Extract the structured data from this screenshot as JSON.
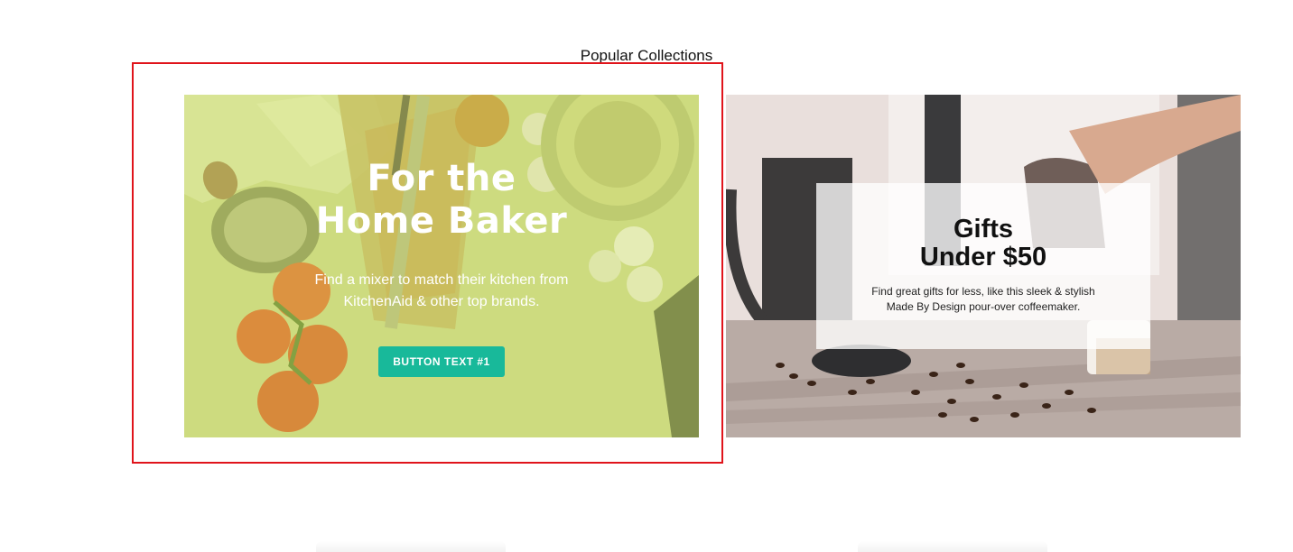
{
  "section": {
    "title": "Popular Collections"
  },
  "cards": [
    {
      "title_line1": "For the",
      "title_line2": "Home Baker",
      "description": "Find a mixer to match their kitchen from KitchenAid & other top brands.",
      "button_label": "BUTTON TEXT #1",
      "overlay_color": "#cfdd82",
      "button_color": "#18b99a"
    },
    {
      "title_line1": "Gifts",
      "title_line2": "Under $50",
      "description": "Find great gifts for less, like this sleek & stylish Made By Design pour-over coffeemaker."
    }
  ],
  "colors": {
    "selection_outline": "#e0141b",
    "background": "#ffffff"
  }
}
